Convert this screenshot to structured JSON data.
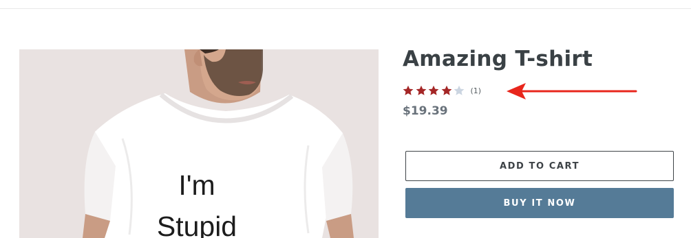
{
  "product": {
    "title": "Amazing T-shirt",
    "image": {
      "shirt_text_line1": "I'm",
      "shirt_text_line2": "Stupid"
    },
    "rating": {
      "value": 4,
      "max": 5,
      "review_count_label": "(1)",
      "filled_color": "#a42626",
      "empty_color": "#cbd5e1"
    },
    "price": "$19.39"
  },
  "actions": {
    "add_to_cart_label": "ADD TO CART",
    "buy_now_label": "BUY IT NOW"
  },
  "annotation": {
    "arrow_color": "#e8261c"
  }
}
